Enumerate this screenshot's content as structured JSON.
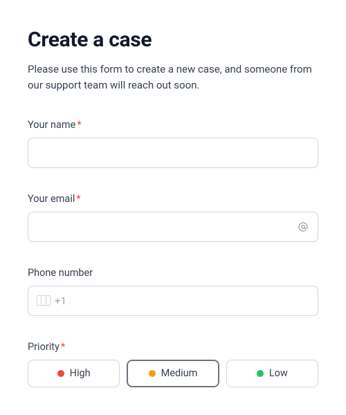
{
  "header": {
    "title": "Create a case",
    "subtitle": "Please use this form to create a new case, and someone from our support team will reach out soon."
  },
  "fields": {
    "name": {
      "label": "Your name",
      "required_mark": "*",
      "value": ""
    },
    "email": {
      "label": "Your email",
      "required_mark": "*",
      "value": "",
      "icon": "at-icon"
    },
    "phone": {
      "label": "Phone number",
      "dial_code": "+1",
      "value": ""
    },
    "priority": {
      "label": "Priority",
      "required_mark": "*",
      "options": {
        "high": "High",
        "medium": "Medium",
        "low": "Low"
      },
      "selected": "medium"
    }
  },
  "colors": {
    "required": "#ef4444",
    "high": "#ef4444",
    "medium": "#f59e0b",
    "low": "#22c55e"
  }
}
